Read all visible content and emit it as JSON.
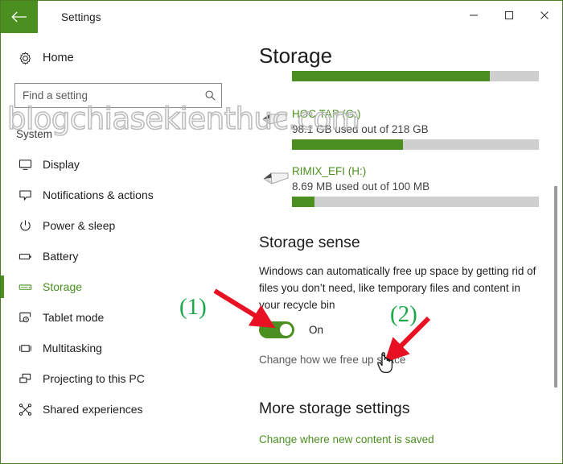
{
  "window": {
    "title": "Settings",
    "back_icon": "back-arrow-icon",
    "minimize_label": "—",
    "maximize_label": "☐",
    "close_label": "✕"
  },
  "sidebar": {
    "home": {
      "label": "Home",
      "icon": "gear-icon"
    },
    "search": {
      "placeholder": "Find a setting",
      "icon": "search-icon"
    },
    "group_label": "System",
    "items": [
      {
        "label": "Display",
        "icon": "monitor-icon",
        "selected": false
      },
      {
        "label": "Notifications & actions",
        "icon": "speech-bubble-icon",
        "selected": false
      },
      {
        "label": "Power & sleep",
        "icon": "power-icon",
        "selected": false
      },
      {
        "label": "Battery",
        "icon": "battery-icon",
        "selected": false
      },
      {
        "label": "Storage",
        "icon": "storage-drive-icon",
        "selected": true
      },
      {
        "label": "Tablet mode",
        "icon": "tablet-hand-icon",
        "selected": false
      },
      {
        "label": "Multitasking",
        "icon": "multitask-icon",
        "selected": false
      },
      {
        "label": "Projecting to this PC",
        "icon": "projecting-icon",
        "selected": false
      },
      {
        "label": "Shared experiences",
        "icon": "share-nodes-icon",
        "selected": false
      }
    ]
  },
  "main": {
    "page_title": "Storage",
    "top_bar_percent": 80,
    "drives": [
      {
        "name": "HOC TAP (G:)",
        "usage": "98.1 GB used out of 218 GB",
        "percent": 45,
        "icon": "usb-drive-icon"
      },
      {
        "name": "RIMIX_EFI (H:)",
        "usage": "8.69 MB used out of 100 MB",
        "percent": 9,
        "icon": "usb-drive-icon"
      }
    ],
    "storage_sense": {
      "title": "Storage sense",
      "description": "Windows can automatically free up space by getting rid of files you don’t need, like temporary files and content in your recycle bin",
      "toggle_state": "On",
      "toggle_on": true,
      "link": "Change how we free up space"
    },
    "more_settings": {
      "title": "More storage settings",
      "link": "Change where new content is saved"
    }
  },
  "annotations": {
    "watermark": "blogchiasekienthuc.com",
    "marker_one": "(1)",
    "marker_two": "(2)",
    "arrow_color": "#e81123",
    "marker_color": "#18a848",
    "cursor_icon": "hand-pointer-cursor"
  },
  "colors": {
    "accent_green": "#4a8f1f",
    "bar_track": "#cfcfcf",
    "window_border": "#4a7c20"
  }
}
